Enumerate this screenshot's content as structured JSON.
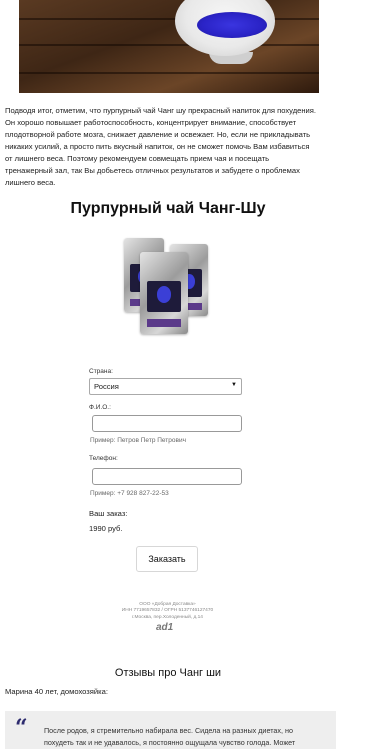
{
  "intro": {
    "text": "Подводя итог, отметим, что пурпурный чай Чанг шу прекрасный напиток для похудения. Он хорошо повышает работоспособность, концентрирует внимание, способствует плодотворной работе мозга, снижает давление и освежает. Но, если не прикладывать никаких усилий, а просто пить вкусный напиток, он не сможет помочь Вам избавиться от лишнего веса. Поэтому рекомендуем совмещать прием чая и посещать тренажерный зал, так Вы добьетесь отличных результатов и забудете о проблемах лишнего веса."
  },
  "product": {
    "title": "Пурпурный чай Чанг-Шу"
  },
  "form": {
    "country_label": "Страна:",
    "country_value": "Россия",
    "name_label": "Ф.И.О.:",
    "name_hint": "Пример: Петров Петр Петрович",
    "phone_label": "Телефон:",
    "phone_hint": "Пример: +7 928 827-22-53",
    "order_label": "Ваш заказ:",
    "price": "1990 руб.",
    "submit_label": "Заказать"
  },
  "footer": {
    "line1": "ООО «Добрая Доставка»",
    "line2": "ИНН 7719657832 / ОГРН 5137746127470",
    "line3": "г.Москва, пер.Холоденный, д.14",
    "logo": "ad1"
  },
  "reviews": {
    "title": "Отзывы про Чанг ши",
    "reviewer": "Марина 40 лет, домохозяйка:",
    "text": "После родов, я стремительно набирала вес. Сидела на разных диетах, но похудеть так и не удавалось, я постоянно ощущала чувство голода. Может"
  },
  "icons": {
    "quote": "quote-icon",
    "dropdown": "chevron-down-icon"
  },
  "colors": {
    "tea_blue": "#2a23c6",
    "quote": "#2d2b6e"
  }
}
